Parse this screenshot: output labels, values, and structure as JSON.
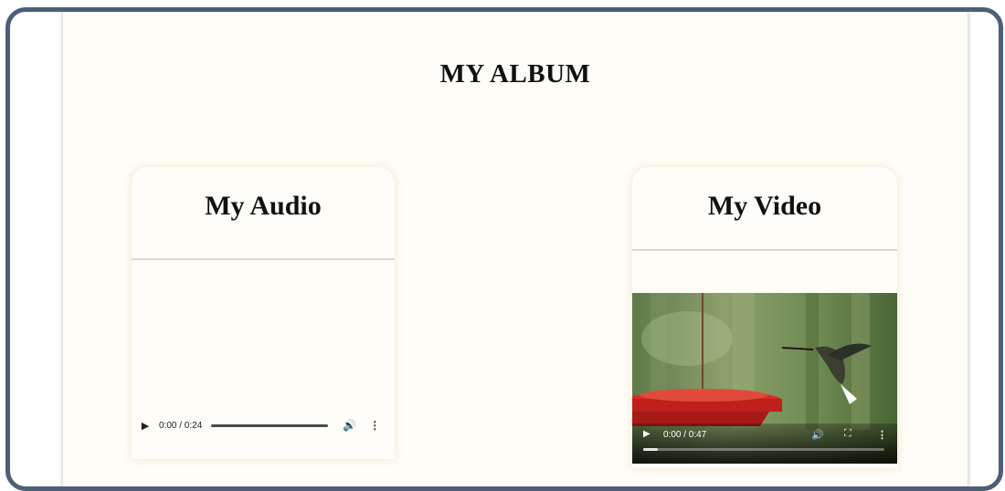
{
  "album": {
    "title": "MY ALBUM"
  },
  "audio_card": {
    "title": "My Audio",
    "player": {
      "time": "0:00 / 0:24",
      "progress": 0
    }
  },
  "video_card": {
    "title": "My Video",
    "player": {
      "time": "0:00 / 0:47",
      "progress": 0.06
    }
  },
  "icons": [
    "play-icon",
    "volume-icon",
    "more-options-icon",
    "fullscreen-icon"
  ]
}
